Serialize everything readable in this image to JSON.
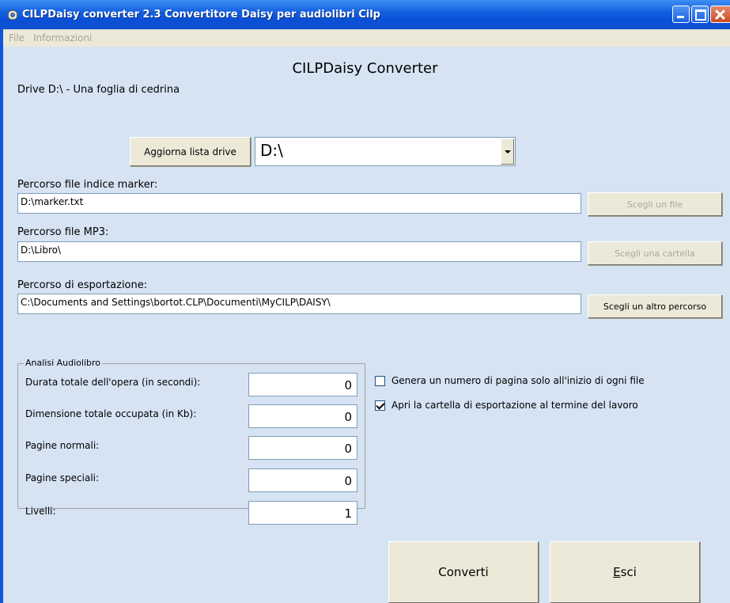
{
  "window": {
    "title": "CILPDaisy converter 2.3 Convertitore Daisy per audiolibri Cilp"
  },
  "menu": {
    "file": "File",
    "info": "Informazioni"
  },
  "header": {
    "app_title": "CILPDaisy Converter",
    "drive_label": "Drive D:\\ - Una foglia di cedrina"
  },
  "drive": {
    "refresh_label": "Aggiorna lista drive",
    "selected": "D:\\"
  },
  "paths": {
    "marker_label": "Percorso file indice marker:",
    "marker_value": "D:\\marker.txt",
    "marker_button": "Scegli un file",
    "mp3_label": "Percorso file MP3:",
    "mp3_value": "D:\\Libro\\",
    "mp3_button": "Scegli una cartella",
    "export_label": "Percorso di esportazione:",
    "export_value": "C:\\Documents and Settings\\bortot.CLP\\Documenti\\MyCILP\\DAISY\\",
    "export_button": "Scegli un altro percorso"
  },
  "analysis": {
    "group_title": "Analisi Audiolibro",
    "rows": [
      {
        "label": "Durata totale dell'opera (in secondi):",
        "value": "0"
      },
      {
        "label": "Dimensione totale occupata (in Kb):",
        "value": "0"
      },
      {
        "label": "Pagine normali:",
        "value": "0"
      },
      {
        "label": "Pagine speciali:",
        "value": "0"
      },
      {
        "label": "Livelli:",
        "value": "1"
      }
    ]
  },
  "options": {
    "page_number_label": "Genera un numero di pagina solo all'inizio di ogni file",
    "page_number_checked": false,
    "open_folder_label": "Apri la cartella di esportazione al termine del lavoro",
    "open_folder_checked": true
  },
  "actions": {
    "convert_label": "Converti",
    "exit_label_first": "E",
    "exit_label_rest": "sci"
  }
}
